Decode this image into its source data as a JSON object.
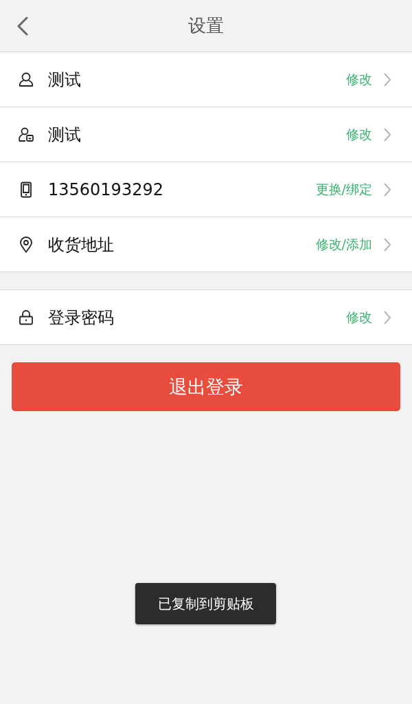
{
  "header": {
    "title": "设置"
  },
  "groups": [
    {
      "rows": [
        {
          "kind": "person",
          "label": "测试",
          "action": "修改"
        },
        {
          "kind": "person-card",
          "label": "测试",
          "action": "修改"
        },
        {
          "kind": "phone",
          "label": "13560193292",
          "action": "更换/绑定"
        },
        {
          "kind": "location",
          "label": "收货地址",
          "action": "修改/添加"
        }
      ]
    },
    {
      "rows": [
        {
          "kind": "lock",
          "label": "登录密码",
          "action": "修改"
        }
      ]
    }
  ],
  "logout_button": {
    "label": "退出登录"
  },
  "toast": {
    "text": "已复制到剪贴板"
  }
}
